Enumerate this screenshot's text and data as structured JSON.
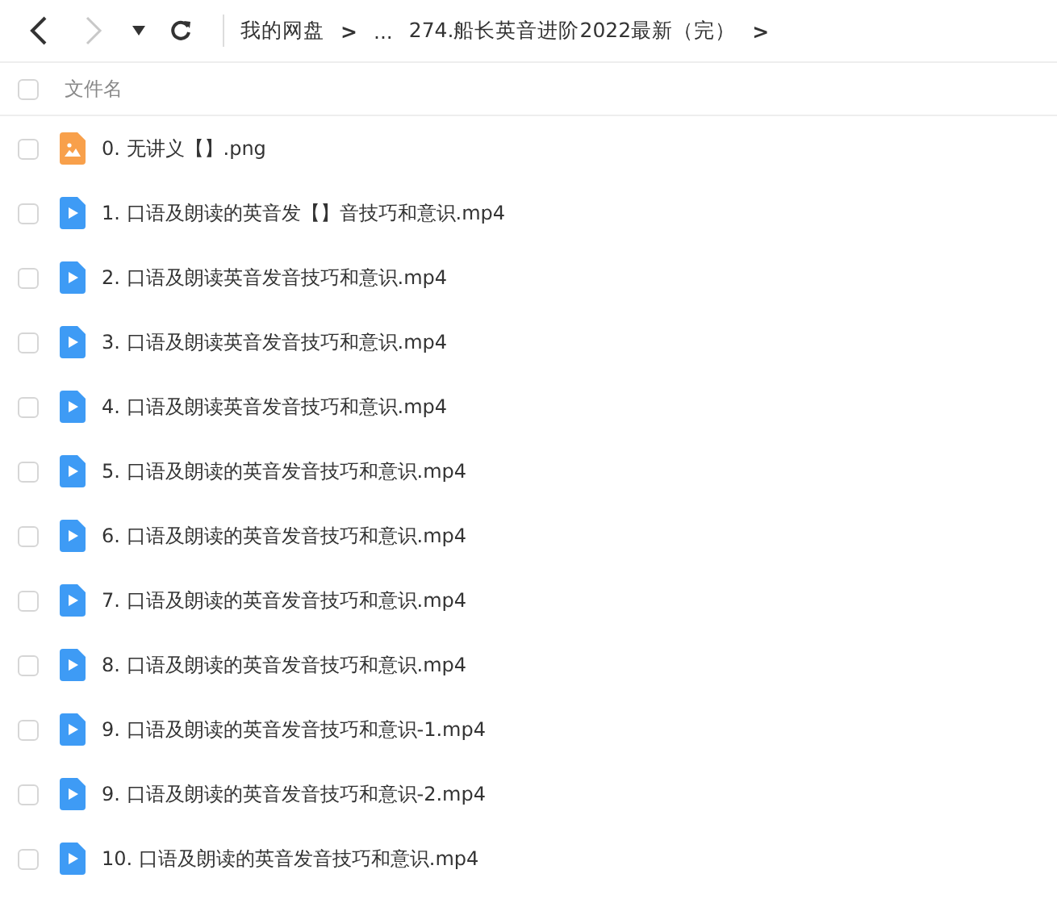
{
  "toolbar": {
    "back": {
      "disabled": false
    },
    "forward": {
      "disabled": true
    },
    "breadcrumb": [
      {
        "kind": "crumb",
        "text": "我的网盘"
      },
      {
        "kind": "sep",
        "text": ">"
      },
      {
        "kind": "crumb",
        "text": "..."
      },
      {
        "kind": "crumb",
        "text": "274.船长英音进阶2022最新（完）"
      },
      {
        "kind": "sep",
        "text": ">"
      }
    ]
  },
  "table": {
    "header": {
      "checked": false,
      "label": "文件名"
    },
    "rows": [
      {
        "kind": "image",
        "name": "0. 无讲义【】.png",
        "checked": false
      },
      {
        "kind": "video",
        "name": "1. 口语及朗读的英音发【】音技巧和意识.mp4",
        "checked": false
      },
      {
        "kind": "video",
        "name": "2. 口语及朗读英音发音技巧和意识.mp4",
        "checked": false
      },
      {
        "kind": "video",
        "name": "3. 口语及朗读英音发音技巧和意识.mp4",
        "checked": false
      },
      {
        "kind": "video",
        "name": "4. 口语及朗读英音发音技巧和意识.mp4",
        "checked": false
      },
      {
        "kind": "video",
        "name": "5. 口语及朗读的英音发音技巧和意识.mp4",
        "checked": false
      },
      {
        "kind": "video",
        "name": "6. 口语及朗读的英音发音技巧和意识.mp4",
        "checked": false
      },
      {
        "kind": "video",
        "name": "7. 口语及朗读的英音发音技巧和意识.mp4",
        "checked": false
      },
      {
        "kind": "video",
        "name": "8. 口语及朗读的英音发音技巧和意识.mp4",
        "checked": false
      },
      {
        "kind": "video",
        "name": "9. 口语及朗读的英音发音技巧和意识-1.mp4",
        "checked": false
      },
      {
        "kind": "video",
        "name": "9. 口语及朗读的英音发音技巧和意识-2.mp4",
        "checked": false
      },
      {
        "kind": "video",
        "name": "10. 口语及朗读的英音发音技巧和意识.mp4",
        "checked": false
      }
    ]
  }
}
